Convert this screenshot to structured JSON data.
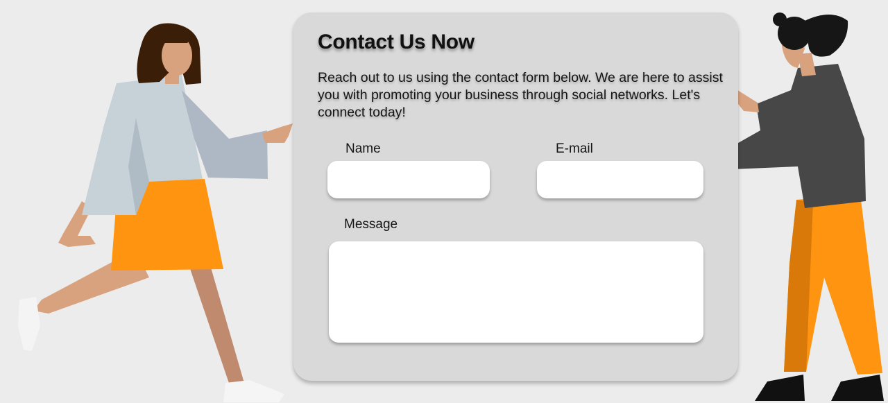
{
  "form": {
    "title": "Contact Us Now",
    "description": "Reach out to us using the contact form below. We are here to assist you with promoting your business through social networks. Let's connect today!",
    "name_label": "Name",
    "name_value": "",
    "email_label": "E-mail",
    "email_value": "",
    "message_label": "Message",
    "message_value": ""
  },
  "colors": {
    "background": "#ececec",
    "card": "#d9d9d9",
    "field": "#ffffff",
    "accent_orange": "#ff9410"
  },
  "illustrations": {
    "left": "running-woman-illustration",
    "right": "woman-with-bun-illustration"
  }
}
